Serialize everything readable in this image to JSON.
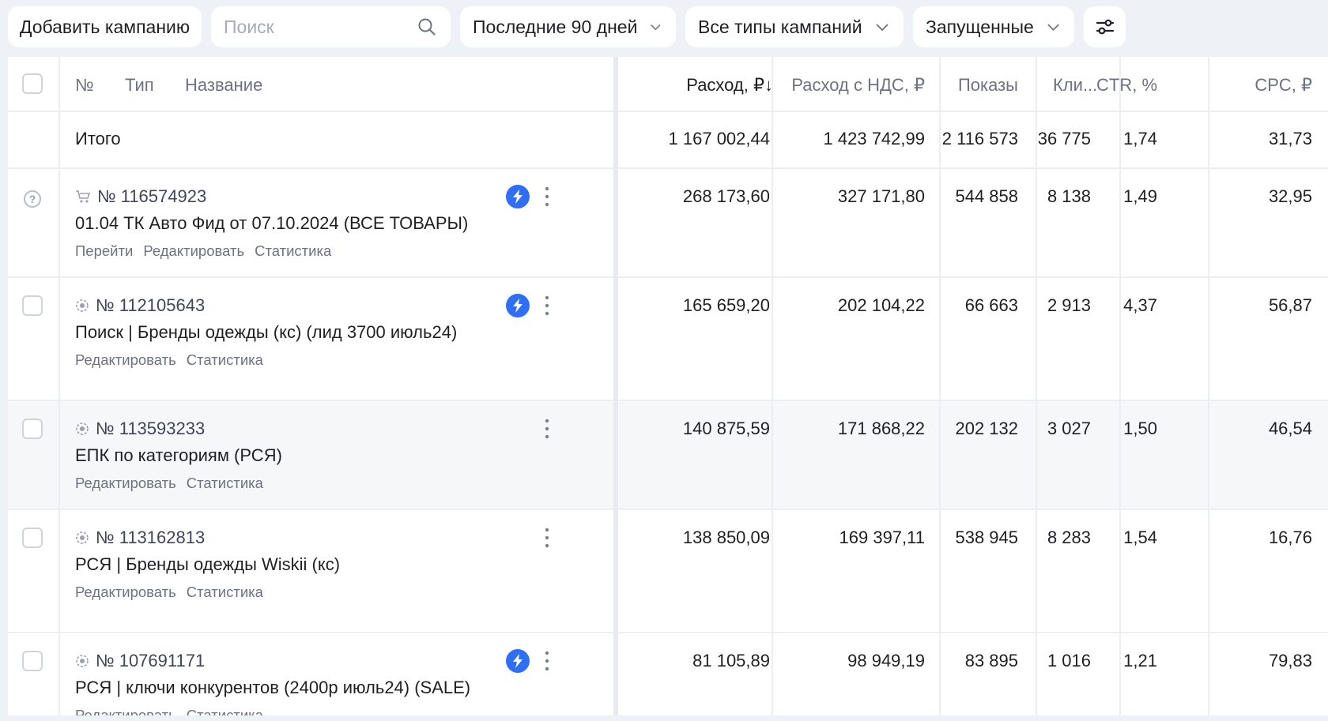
{
  "toolbar": {
    "add_label": "Добавить кампанию",
    "search_placeholder": "Поиск",
    "period_label": "Последние 90 дней",
    "types_label": "Все типы кампаний",
    "status_label": "Запущенные"
  },
  "table": {
    "headers": {
      "num": "№",
      "type": "Тип",
      "name": "Название",
      "spend": "Расход, ₽↓",
      "spend_vat": "Расход с НДС, ₽",
      "impressions": "Показы",
      "clicks": "Кли...",
      "ctr": "CTR, %",
      "cpc": "CPC, ₽"
    },
    "total": {
      "label": "Итого",
      "spend": "1 167 002,44",
      "spend_vat": "1 423 742,99",
      "impressions": "2 116 573",
      "clicks": "36 775",
      "ctr": "1,74",
      "cpc": "31,73"
    },
    "rows": [
      {
        "id": "№ 116574923",
        "name": "01.04 ТК Авто Фид от 07.10.2024 (ВСЕ ТОВАРЫ)",
        "links": [
          "Перейти",
          "Редактировать",
          "Статистика"
        ],
        "spend": "268 173,60",
        "spend_vat": "327 171,80",
        "impressions": "544 858",
        "clicks": "8 138",
        "ctr": "1,49",
        "cpc": "32,95"
      },
      {
        "id": "№ 112105643",
        "name": "Поиск | Бренды одежды (кс) (лид 3700 июль24)",
        "links": [
          "Редактировать",
          "Статистика"
        ],
        "spend": "165 659,20",
        "spend_vat": "202 104,22",
        "impressions": "66 663",
        "clicks": "2 913",
        "ctr": "4,37",
        "cpc": "56,87"
      },
      {
        "id": "№ 113593233",
        "name": "ЕПК по категориям (РСЯ)",
        "links": [
          "Редактировать",
          "Статистика"
        ],
        "spend": "140 875,59",
        "spend_vat": "171 868,22",
        "impressions": "202 132",
        "clicks": "3 027",
        "ctr": "1,50",
        "cpc": "46,54"
      },
      {
        "id": "№ 113162813",
        "name": "РСЯ | Бренды одежды Wiskii (кс)",
        "links": [
          "Редактировать",
          "Статистика"
        ],
        "spend": "138 850,09",
        "spend_vat": "169 397,11",
        "impressions": "538 945",
        "clicks": "8 283",
        "ctr": "1,54",
        "cpc": "16,76"
      },
      {
        "id": "№ 107691171",
        "name": "РСЯ | ключи конкурентов (2400р июль24) (SALE)",
        "links": [
          "Редактировать",
          "Статистика"
        ],
        "spend": "81 105,89",
        "spend_vat": "98 949,19",
        "impressions": "83 895",
        "clicks": "1 016",
        "ctr": "1,21",
        "cpc": "79,83"
      }
    ]
  },
  "icons": {
    "search": "search-icon",
    "chevron": "chevron-down-icon",
    "filter": "filter-settings-icon",
    "autostrategy": "bolt-icon",
    "more": "more-vertical-icon",
    "cart": "cart-icon",
    "target": "target-icon",
    "help": "help-icon"
  },
  "colors": {
    "accent": "#2f6ff5",
    "background": "#eef1f6",
    "muted_text": "#6d7282"
  }
}
